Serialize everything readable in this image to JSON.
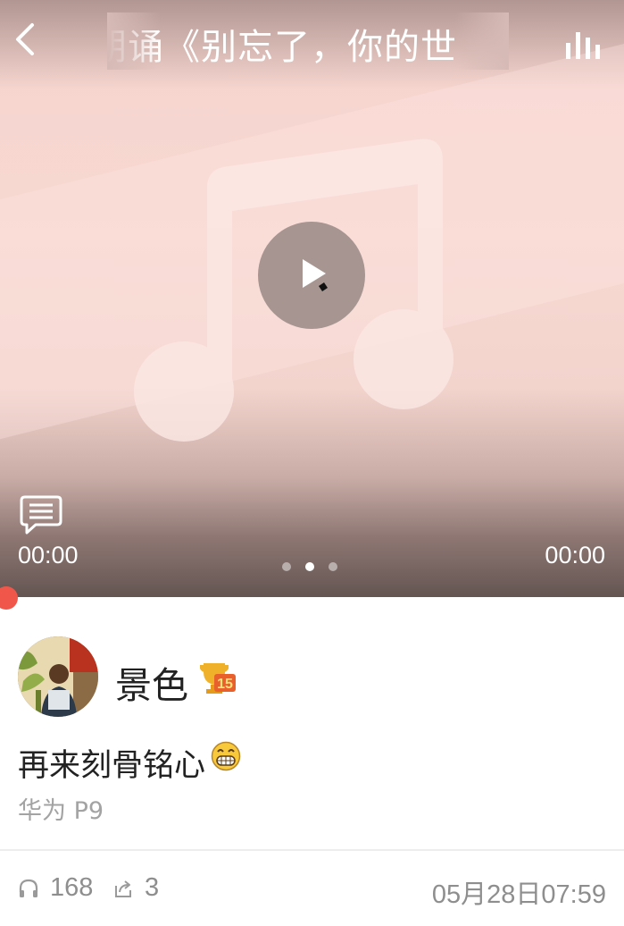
{
  "header": {
    "title": "朗诵《别忘了，你的世",
    "back_icon": "back-arrow-icon",
    "stats_icon": "bar-chart-icon"
  },
  "player": {
    "time_current": "00:00",
    "time_total": "00:00",
    "play_icon": "play-icon",
    "comment_icon": "comment-icon",
    "page_dots": {
      "count": 3,
      "active_index": 1
    },
    "progress": 0,
    "colors": {
      "accent": "#f0574a"
    }
  },
  "post": {
    "username": "景色",
    "level_badge": "15",
    "text": "再来刻骨铭心",
    "emoji": "grin-emoji-icon",
    "device": "华为 P9"
  },
  "stats": {
    "listens": "168",
    "shares": "3",
    "timestamp": "05月28日07:59",
    "listen_icon": "headphones-icon",
    "share_icon": "share-icon"
  }
}
